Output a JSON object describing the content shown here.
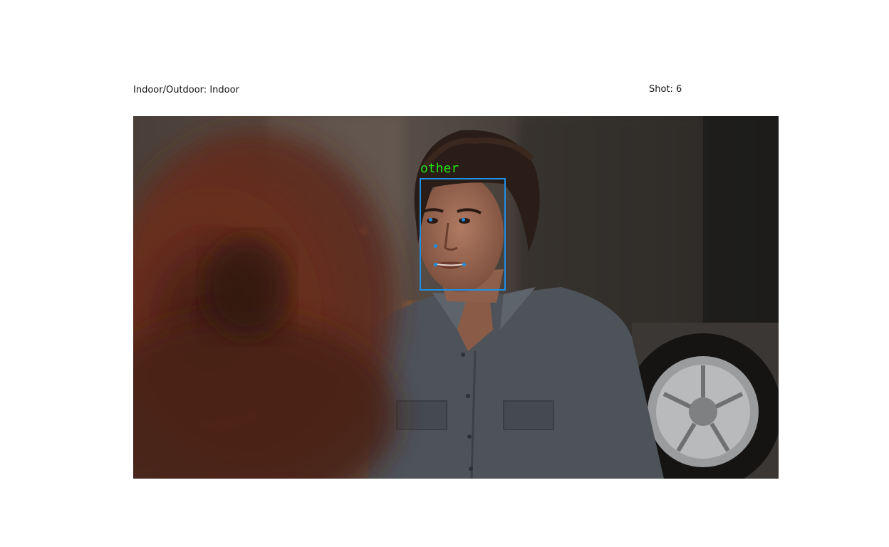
{
  "header": {
    "left_text": "Indoor/Outdoor: Indoor",
    "right_text": "Shot: 6"
  },
  "detection": {
    "label": "other",
    "label_color": "#22e61a",
    "box_color": "#1e90e6",
    "keypoint_color": "#1e90e6",
    "keypoints": [
      "left-eye",
      "right-eye",
      "nose",
      "mouth-left",
      "mouth-right"
    ]
  },
  "scene": {
    "description_icon": "film-still"
  }
}
